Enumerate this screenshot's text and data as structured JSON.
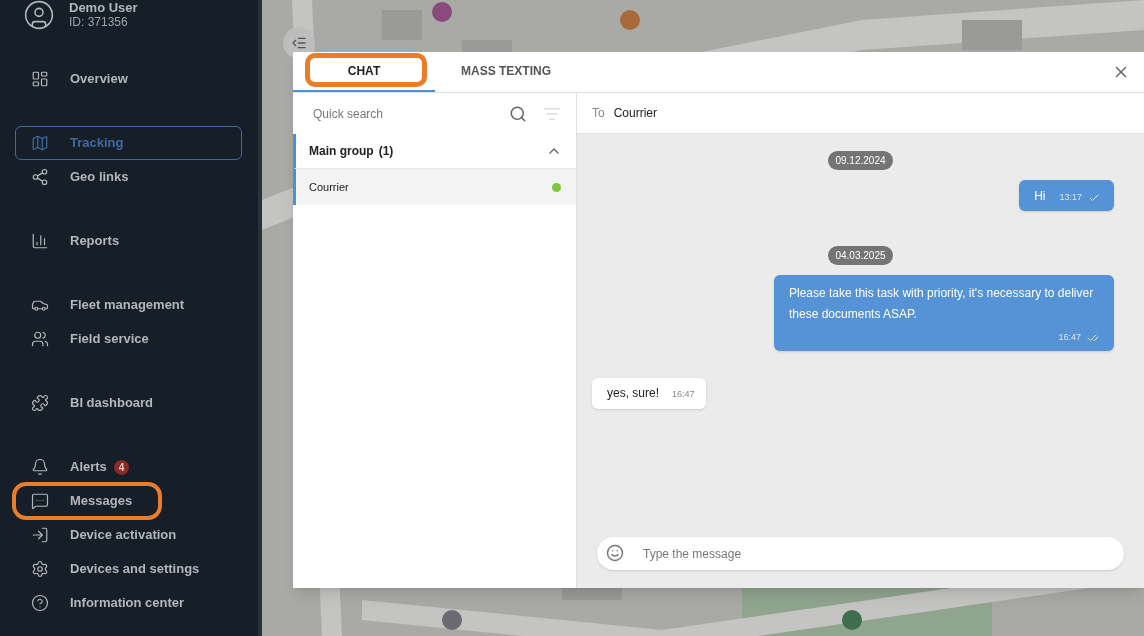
{
  "user": {
    "name": "Demo User",
    "id": "ID: 371356"
  },
  "nav_groups": [
    {
      "items": [
        {
          "label": "Overview",
          "selected": false,
          "highlighted": false
        }
      ]
    },
    {
      "items": [
        {
          "label": "Tracking",
          "selected": true,
          "highlighted": false
        },
        {
          "label": "Geo links",
          "selected": false,
          "highlighted": false
        }
      ]
    },
    {
      "items": [
        {
          "label": "Reports",
          "selected": false,
          "highlighted": false
        }
      ]
    },
    {
      "items": [
        {
          "label": "Fleet management",
          "selected": false,
          "highlighted": false
        },
        {
          "label": "Field service",
          "selected": false,
          "highlighted": false
        }
      ]
    },
    {
      "items": [
        {
          "label": "BI dashboard",
          "selected": false,
          "highlighted": false
        }
      ]
    },
    {
      "items": [
        {
          "label": "Alerts",
          "badge": "4",
          "selected": false,
          "highlighted": false
        },
        {
          "label": "Messages",
          "selected": false,
          "highlighted": true
        },
        {
          "label": "Device activation",
          "selected": false,
          "highlighted": false
        },
        {
          "label": "Devices and settings",
          "selected": false,
          "highlighted": false
        },
        {
          "label": "Information center",
          "selected": false,
          "highlighted": false
        }
      ]
    }
  ],
  "dialog": {
    "tabs": [
      {
        "label": "CHAT",
        "selected": true,
        "highlighted": true
      },
      {
        "label": "MASS TEXTING",
        "selected": false,
        "highlighted": false
      }
    ],
    "search": {
      "placeholder": "Quick search"
    },
    "groups": [
      {
        "name": "Main group",
        "count": "(1)",
        "expanded": true,
        "contacts": [
          {
            "name": "Courrier",
            "selected": true,
            "color": "#7cc83a"
          }
        ]
      }
    ],
    "to_label": "To",
    "to_value": "Courrier",
    "messages": [
      {
        "kind": "date",
        "text": "09.12.2024"
      },
      {
        "kind": "outgoing",
        "text": "Hi",
        "time": "13:17",
        "read": false
      },
      {
        "kind": "date",
        "text": "04.03.2025"
      },
      {
        "kind": "outgoing",
        "text": "Please take this task with priority, it's necessary to deliver these documents ASAP.",
        "time": "16:47",
        "read": true
      },
      {
        "kind": "incoming",
        "text": "yes, sure!",
        "time": "16:47"
      }
    ],
    "composer": {
      "placeholder": "Type the message"
    }
  }
}
